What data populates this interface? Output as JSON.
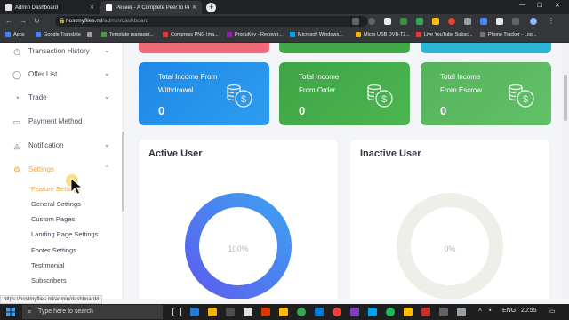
{
  "browser": {
    "tabs": [
      {
        "title": "Admin Dashboard",
        "active": false
      },
      {
        "title": "Pexeer - A Complete Peer to Peer",
        "active": true
      }
    ],
    "new_tab": "+",
    "window_controls": {
      "minimize": "—",
      "maximize": "☐",
      "close": "✕"
    },
    "url_host": "hostmyfiles.ml",
    "url_path": "/admin/dashboard",
    "status_url": "https://hostmyfiles.ml/admin/dashboard#",
    "bookmarks": [
      {
        "label": "Apps",
        "color": "#4285f4"
      },
      {
        "label": "Google Translate",
        "color": "#4285f4"
      },
      {
        "label": "",
        "color": "#9e9e9e"
      },
      {
        "label": "Template manager...",
        "color": "#43a047"
      },
      {
        "label": "Compress PNG Ima...",
        "color": "#e53935"
      },
      {
        "label": "ProduKey - Recover...",
        "color": "#8e24aa"
      },
      {
        "label": "Microsoft Windows...",
        "color": "#00a4ef"
      },
      {
        "label": "Micro USB DVB-T2...",
        "color": "#ffb300"
      },
      {
        "label": "Live YouTube Subsc...",
        "color": "#e53935"
      },
      {
        "label": "Phone Tracker - Log...",
        "color": "#757575"
      }
    ]
  },
  "sidebar": {
    "items": [
      {
        "label": "Transaction History",
        "icon": "clock-icon",
        "glyph": "◷",
        "chevron": "⌄"
      },
      {
        "label": "Offer List",
        "icon": "tag-icon",
        "glyph": "◯",
        "chevron": "⌄"
      },
      {
        "label": "Trade",
        "icon": "trade-icon",
        "glyph": "◔",
        "chevron": "⌄"
      },
      {
        "label": "Payment Method",
        "icon": "wallet-icon",
        "glyph": "▭",
        "chevron": ""
      },
      {
        "label": "Notification",
        "icon": "bell-icon",
        "glyph": "◬",
        "chevron": "⌄"
      },
      {
        "label": "Settings",
        "icon": "gear-icon",
        "glyph": "⚙",
        "chevron": "⌃"
      }
    ],
    "settings_submenu": [
      "Feature Settings",
      "General Settings",
      "Custom Pages",
      "Landing Page Settings",
      "Footer Settings",
      "Testimonial",
      "Subscribers"
    ]
  },
  "stats": [
    {
      "line1": "Total Income From",
      "line2": "Withdrawal",
      "value": "0",
      "color": "#1e88e5"
    },
    {
      "line1": "Total Income",
      "line2": "From Order",
      "value": "0",
      "color": "#43a84a"
    },
    {
      "line1": "Total Income",
      "line2": "From Escrow",
      "value": "0",
      "color": "#5cb85c"
    }
  ],
  "cards": [
    {
      "title": "Active User",
      "percent_label": "100%",
      "percent": 100
    },
    {
      "title": "Inactive User",
      "percent_label": "0%",
      "percent": 0
    }
  ],
  "taskbar": {
    "search_placeholder": "Type here to search",
    "language": "ENG",
    "time": "20:55"
  },
  "colors": {
    "accent": "#e8a23a",
    "donut_start": "#5b5ef0",
    "donut_end": "#3fa0f0",
    "strip_pink": "#f06a7a",
    "strip_green": "#43a84a",
    "strip_cyan": "#2bb6d8"
  }
}
